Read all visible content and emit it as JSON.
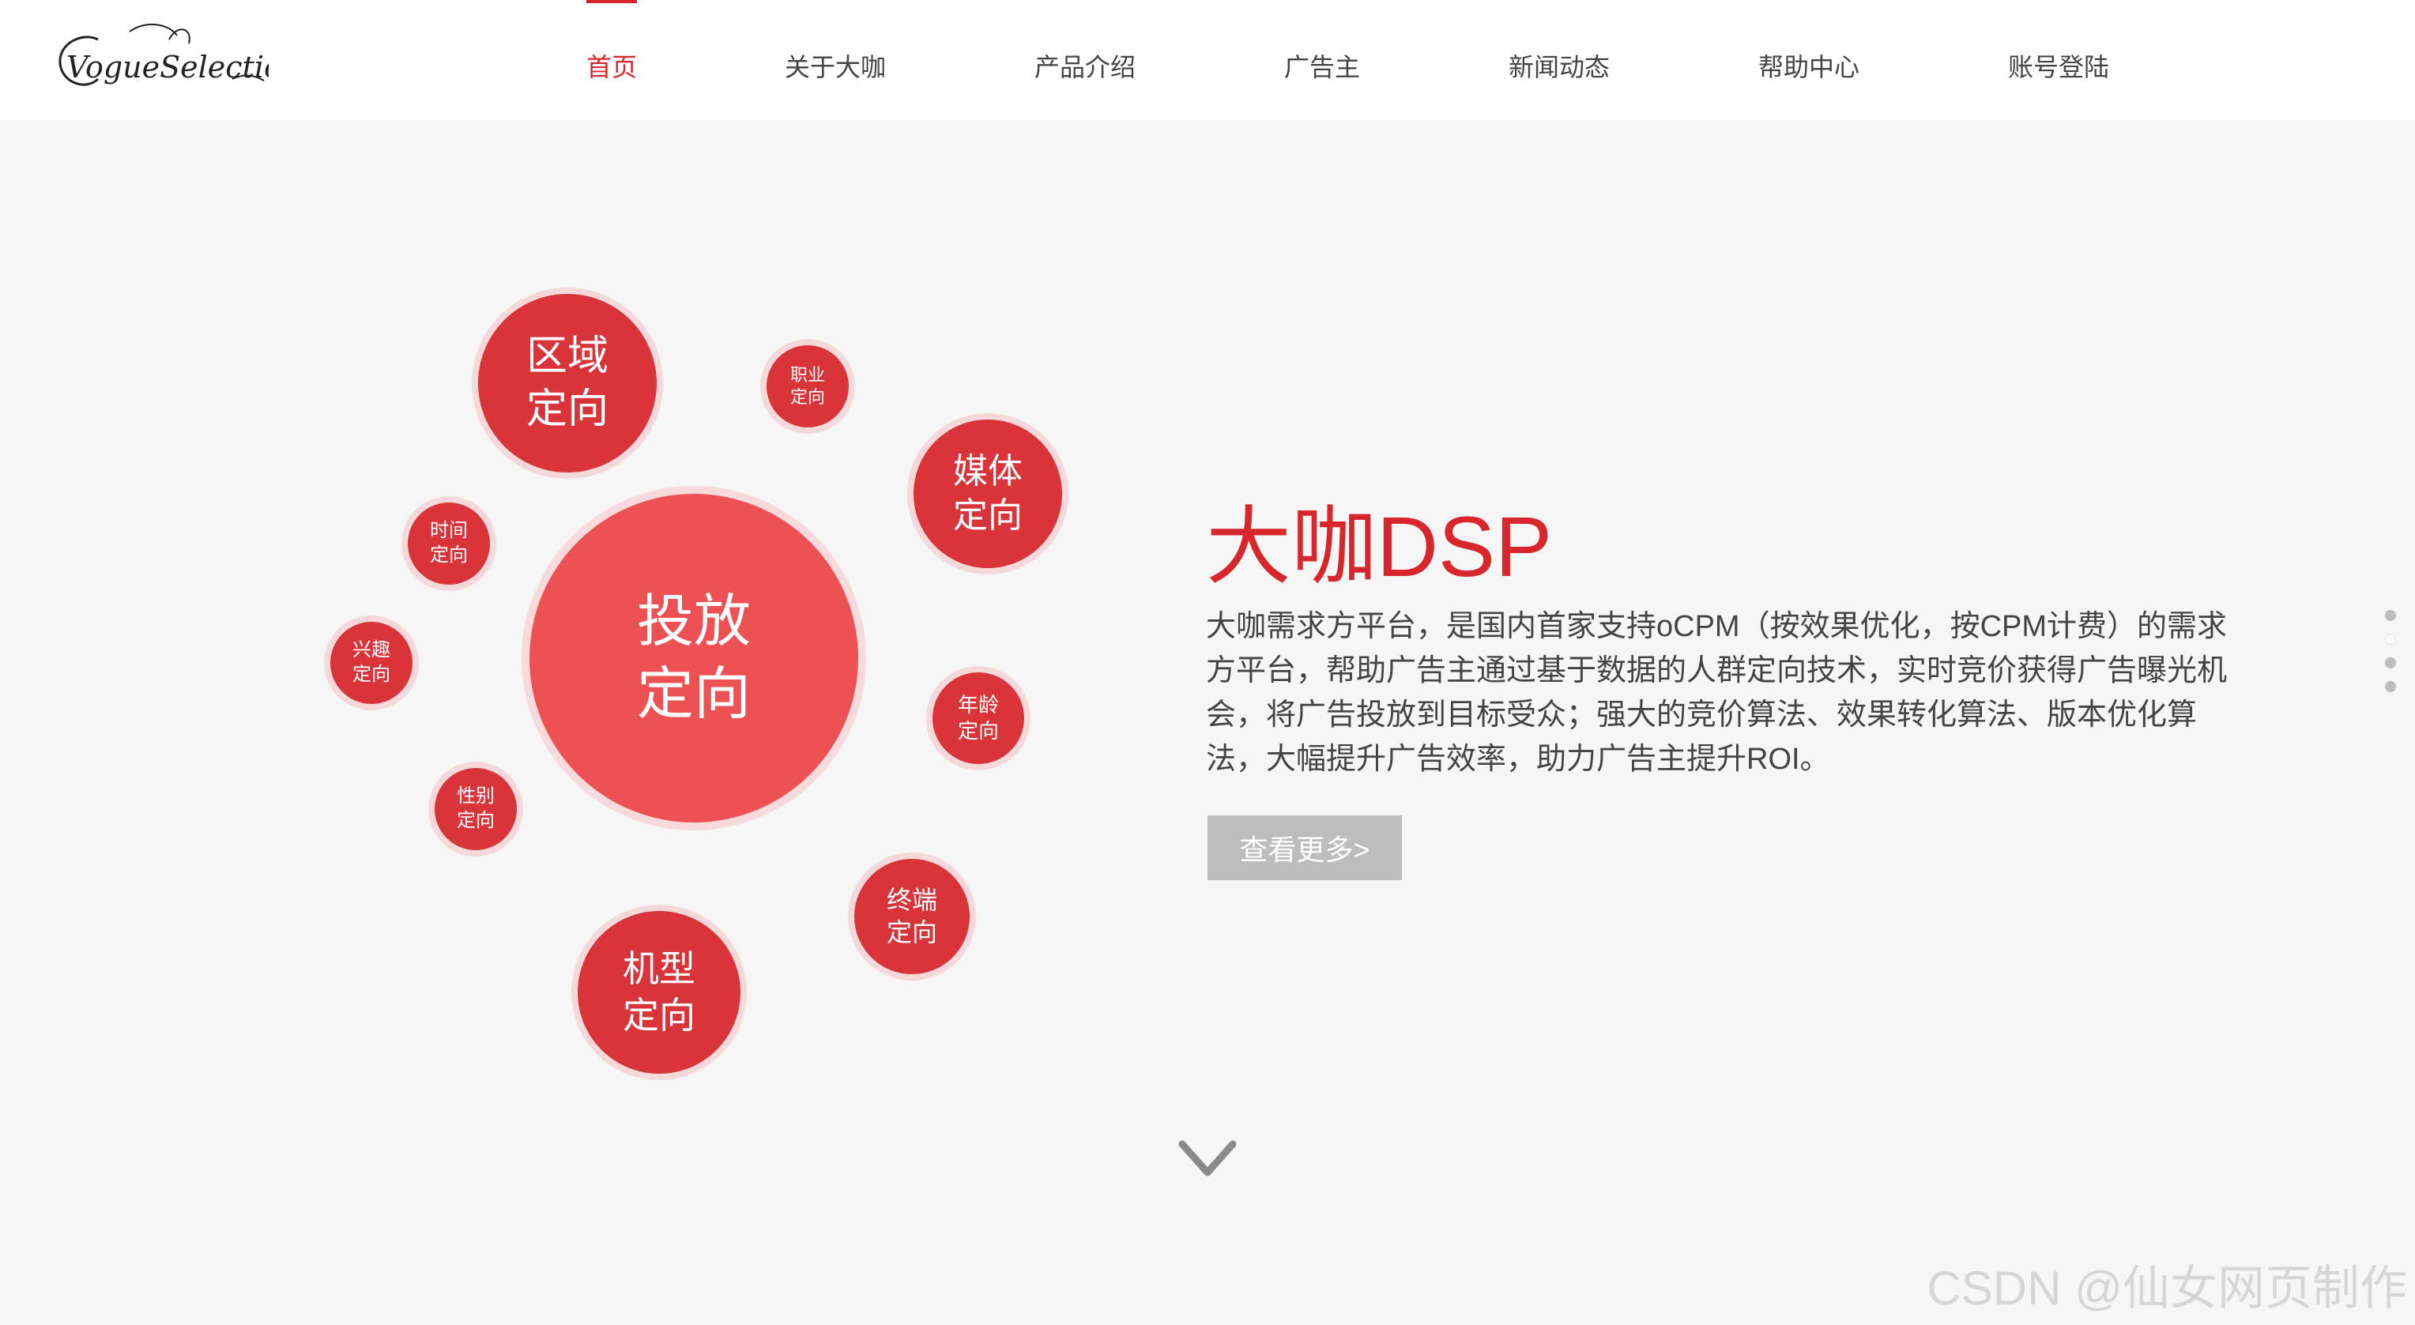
{
  "header": {
    "logo_text": "VogueSelection",
    "nav": [
      {
        "label": "首页"
      },
      {
        "label": "关于大咖"
      },
      {
        "label": "产品介绍"
      },
      {
        "label": "广告主"
      },
      {
        "label": "新闻动态"
      },
      {
        "label": "帮助中心"
      },
      {
        "label": "账号登陆"
      }
    ],
    "active_index": 0
  },
  "bubbles": {
    "center": {
      "line1": "投放",
      "line2": "定向"
    },
    "region": {
      "line1": "区域",
      "line2": "定向"
    },
    "occupation": {
      "line1": "职业",
      "line2": "定向"
    },
    "media": {
      "line1": "媒体",
      "line2": "定向"
    },
    "time": {
      "line1": "时间",
      "line2": "定向"
    },
    "interest": {
      "line1": "兴趣",
      "line2": "定向"
    },
    "age": {
      "line1": "年龄",
      "line2": "定向"
    },
    "gender": {
      "line1": "性别",
      "line2": "定向"
    },
    "terminal": {
      "line1": "终端",
      "line2": "定向"
    },
    "model": {
      "line1": "机型",
      "line2": "定向"
    }
  },
  "content": {
    "title": "大咖DSP",
    "description": "大咖需求方平台，是国内首家支持oCPM（按效果优化，按CPM计费）的需求方平台，帮助广告主通过基于数据的人群定向技术，实时竞价获得广告曝光机会，将广告投放到目标受众；强大的竞价算法、效果转化算法、版本优化算法，大幅提升广告效率，助力广告主提升ROI。",
    "more_button": "查看更多>"
  },
  "watermark": "CSDN @仙女网页制作",
  "colors": {
    "accent": "#d7262c",
    "bubble": "#d8343a",
    "bubble_center": "#ee5154",
    "background": "#f7f6f6"
  },
  "icons": {
    "down": "chevron-down-icon"
  }
}
